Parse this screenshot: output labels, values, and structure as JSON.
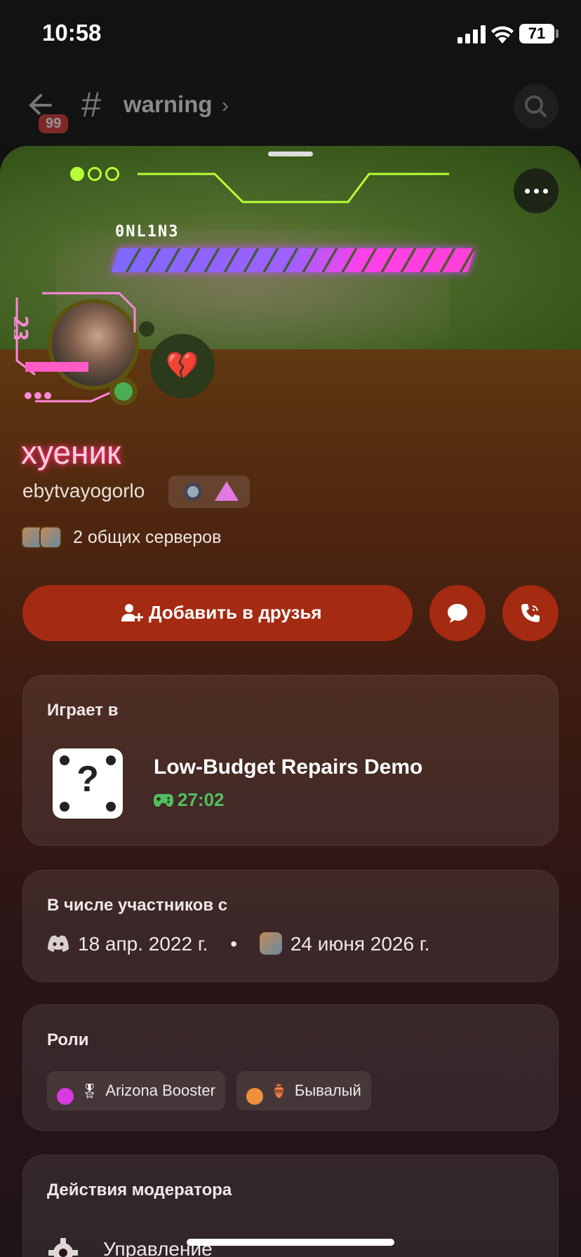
{
  "status_bar": {
    "time": "10:58",
    "battery": "71"
  },
  "nav": {
    "back_badge": "99",
    "channel_name": "warning"
  },
  "banner": {
    "online_label": "0NL1N3"
  },
  "profile": {
    "display_name": "хуеник",
    "username": "ebytvayogorlo",
    "status_emoji": "💔",
    "mutual_servers": "2 общих серверов",
    "name_glow_color": "#ff2b6a",
    "status_color": "#4bae55"
  },
  "actions": {
    "add_friend": "Добавить в друзья",
    "accent_color": "#a52a12"
  },
  "playing": {
    "title": "Играет в",
    "game_name": "Low-Budget Repairs Demo",
    "elapsed": "27:02",
    "icon": "random-dice-question-icon"
  },
  "member_since": {
    "title": "В числе участников с",
    "discord_date": "18 апр. 2022 г.",
    "separator": "•",
    "server_date": "24 июня 2026 г."
  },
  "roles": {
    "title": "Роли",
    "items": [
      {
        "name": "Arizona Booster",
        "color": "#d63ae0",
        "emoji": "🎖"
      },
      {
        "name": "Бывалый",
        "color": "#f0903a",
        "emoji": "🏺"
      }
    ]
  },
  "moderator": {
    "title": "Действия модератора",
    "manage": "Управление"
  }
}
